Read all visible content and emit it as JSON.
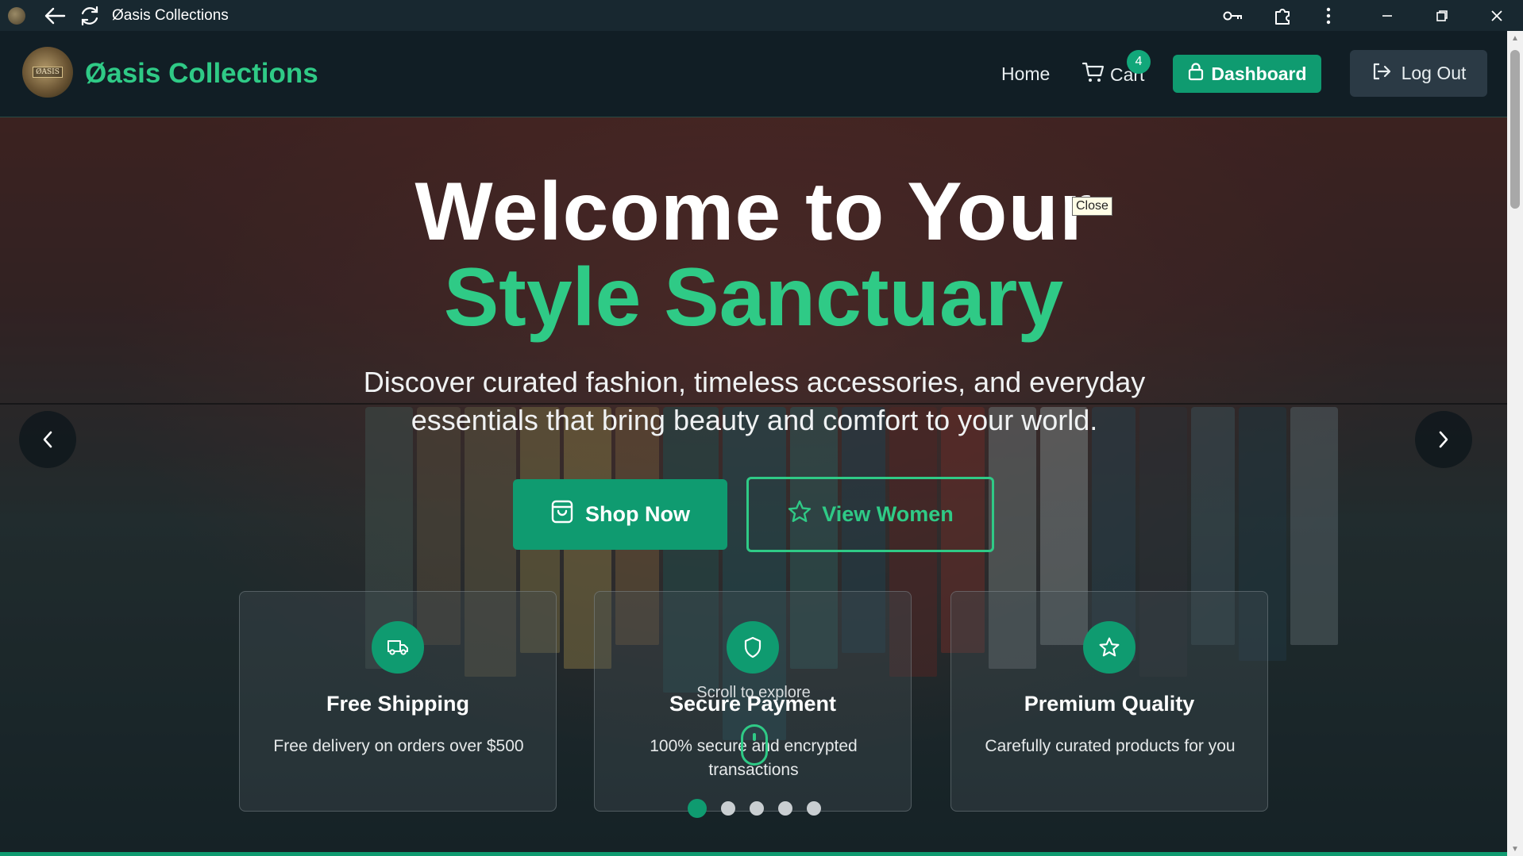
{
  "window": {
    "title": "Øasis Collections",
    "back_icon": "arrow-left-icon",
    "reload_icon": "reload-icon",
    "key_icon": "key-icon",
    "extensions_icon": "puzzle-icon",
    "menu_icon": "more-vertical-icon"
  },
  "nav": {
    "logo_text": "ØASIS",
    "brand": "Øasis Collections",
    "home": "Home",
    "cart": "Cart",
    "cart_count": "4",
    "dashboard": "Dashboard",
    "logout": "Log Out"
  },
  "hero": {
    "title_line1": "Welcome to Your",
    "title_line2": "Style Sanctuary",
    "subtitle": "Discover curated fashion, timeless accessories, and everyday essentials that bring beauty and comfort to your world.",
    "tooltip": "Close",
    "shop_button": "Shop Now",
    "women_button": "View Women",
    "scroll_hint": "Scroll to explore",
    "slide_count": 5,
    "active_slide": 1
  },
  "features": [
    {
      "icon": "truck-icon",
      "title": "Free Shipping",
      "desc": "Free delivery on orders over $500"
    },
    {
      "icon": "shield-icon",
      "title": "Secure Payment",
      "desc": "100% secure and encrypted transactions"
    },
    {
      "icon": "star-icon",
      "title": "Premium Quality",
      "desc": "Carefully curated products for you"
    }
  ],
  "colors": {
    "accent": "#2fca86",
    "button": "#0f9b70",
    "navbar": "#111e25",
    "titlebar": "#182830"
  }
}
